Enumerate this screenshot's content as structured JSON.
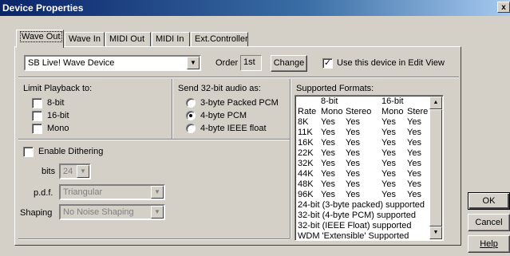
{
  "window": {
    "title": "Device Properties",
    "close_glyph": "x"
  },
  "tabs": [
    {
      "label": "Wave Out",
      "active": true
    },
    {
      "label": "Wave In",
      "active": false
    },
    {
      "label": "MIDI Out",
      "active": false
    },
    {
      "label": "MIDI In",
      "active": false
    },
    {
      "label": "Ext.Controller",
      "active": false
    }
  ],
  "device": {
    "selected": "SB Live! Wave Device",
    "order_label": "Order",
    "order_value": "1st",
    "change_label": "Change",
    "use_in_edit_view": {
      "label": "Use this device in Edit View",
      "checked": true
    }
  },
  "limit_playback": {
    "label": "Limit Playback to:",
    "options": [
      {
        "label": "8-bit",
        "checked": false
      },
      {
        "label": "16-bit",
        "checked": false
      },
      {
        "label": "Mono",
        "checked": false
      }
    ]
  },
  "send32": {
    "label": "Send 32-bit audio as:",
    "options": [
      {
        "label": "3-byte Packed PCM",
        "selected": false
      },
      {
        "label": "4-byte PCM",
        "selected": true
      },
      {
        "label": "4-byte IEEE float",
        "selected": false
      }
    ]
  },
  "dithering": {
    "enable_label": "Enable Dithering",
    "enabled": false,
    "bits_label": "bits",
    "bits_value": "24",
    "pdf_label": "p.d.f.",
    "pdf_value": "Triangular",
    "shaping_label": "Shaping",
    "shaping_value": "No Noise Shaping"
  },
  "formats": {
    "label": "Supported Formats:",
    "group_header": [
      "",
      "8-bit",
      "",
      "16-bit",
      ""
    ],
    "column_header": [
      "Rate",
      "Mono",
      "Stereo",
      "Mono",
      "Stere"
    ],
    "rows": [
      [
        "8K",
        "Yes",
        "Yes",
        "Yes",
        "Yes"
      ],
      [
        "11K",
        "Yes",
        "Yes",
        "Yes",
        "Yes"
      ],
      [
        "16K",
        "Yes",
        "Yes",
        "Yes",
        "Yes"
      ],
      [
        "22K",
        "Yes",
        "Yes",
        "Yes",
        "Yes"
      ],
      [
        "32K",
        "Yes",
        "Yes",
        "Yes",
        "Yes"
      ],
      [
        "44K",
        "Yes",
        "Yes",
        "Yes",
        "Yes"
      ],
      [
        "48K",
        "Yes",
        "Yes",
        "Yes",
        "Yes"
      ],
      [
        "96K",
        "Yes",
        "Yes",
        "Yes",
        "Yes"
      ]
    ],
    "notes": [
      "24-bit (3-byte packed) supported",
      "32-bit (4-byte PCM) supported",
      "32-bit (IEEE Float) supported",
      "WDM 'Extensible' Supported"
    ]
  },
  "buttons": {
    "ok": "OK",
    "cancel": "Cancel",
    "help": "Help"
  }
}
